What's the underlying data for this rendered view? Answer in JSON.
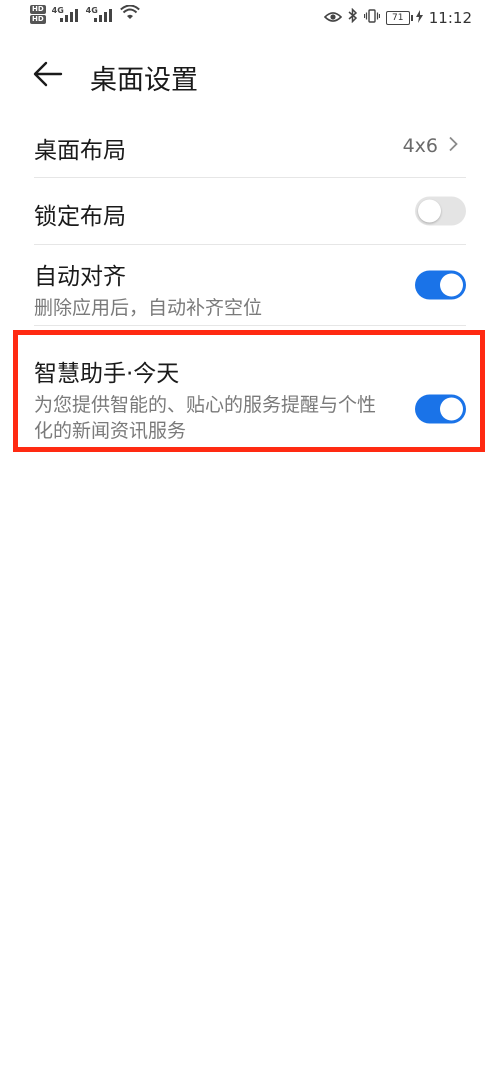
{
  "status_bar": {
    "hd1": "HD",
    "hd2": "HD",
    "sim1": "4G",
    "sim2": "4G",
    "battery": "71",
    "time": "11:12"
  },
  "header": {
    "title": "桌面设置"
  },
  "settings": {
    "layout": {
      "title": "桌面布局",
      "value": "4x6"
    },
    "lock_layout": {
      "title": "锁定布局",
      "enabled": false
    },
    "auto_align": {
      "title": "自动对齐",
      "subtitle": "删除应用后，自动补齐空位",
      "enabled": true
    },
    "smart_assistant": {
      "title": "智慧助手·今天",
      "subtitle": "为您提供智能的、贴心的服务提醒与个性化的新闻资讯服务",
      "enabled": true
    }
  },
  "colors": {
    "accent": "#1a73e8",
    "highlight_border": "#ff2a12"
  }
}
